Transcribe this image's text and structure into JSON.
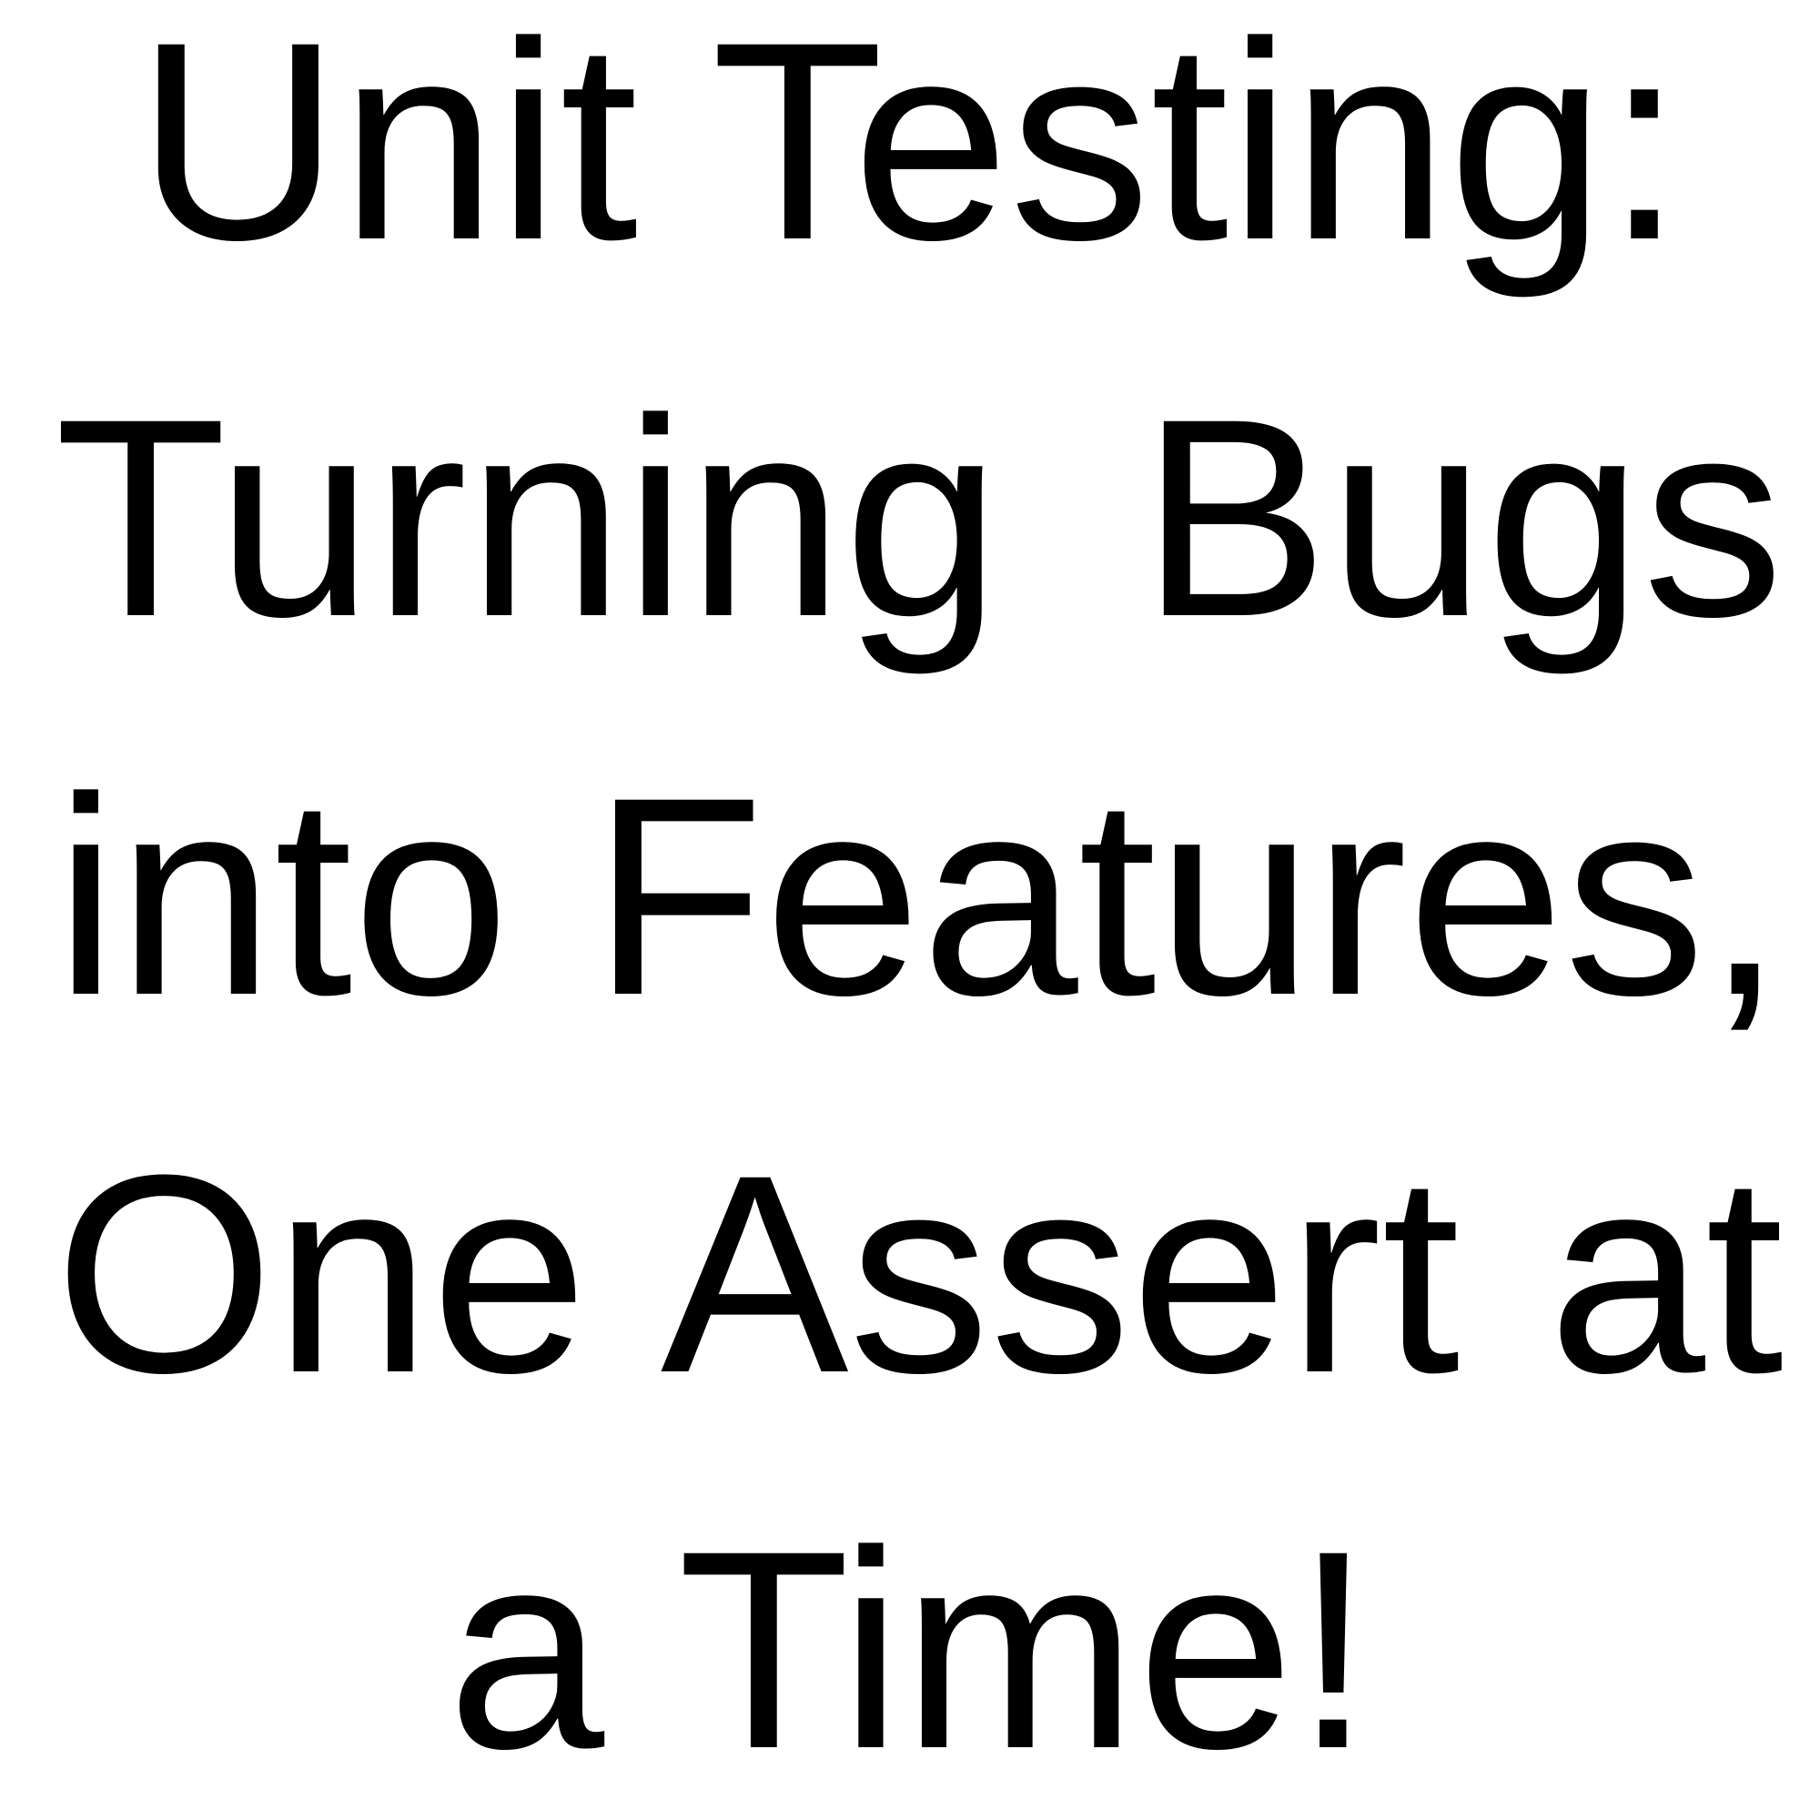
{
  "title": {
    "lines": [
      "Unit Testing:",
      "Turning Bugs",
      "into Features,",
      "One Assert at",
      "a Time!"
    ]
  },
  "colors": {
    "background": "#ffffff",
    "text": "#000000"
  }
}
